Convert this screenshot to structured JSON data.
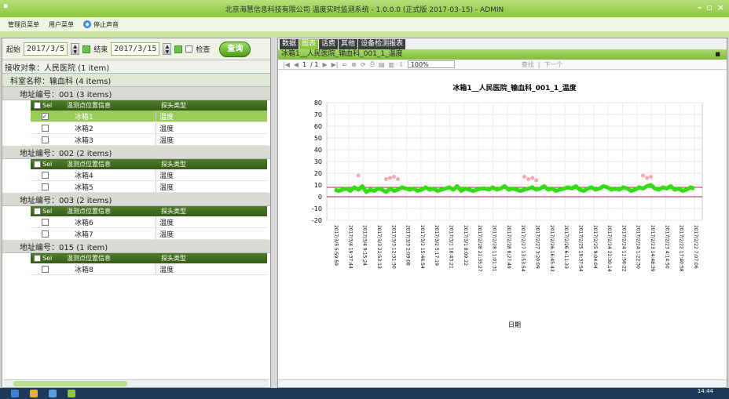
{
  "window": {
    "title": "北京海慧信息科技有限公司 温度实时监测系统 - 1.0.0.0 (正式版 2017-03-15) - ADMIN",
    "icon": "app-icon"
  },
  "menu": {
    "admin": "管理员菜单",
    "user": "用户菜单",
    "stop_sound": "停止声音"
  },
  "filter": {
    "start_label": "起始",
    "start_value": "2017/3/5",
    "end_label": "结束",
    "end_value": "2017/3/15",
    "check_label": "检查",
    "query_label": "查询"
  },
  "tree": {
    "recipient": "接收对象：人民医院 (1 item)",
    "dept": "科室名称：输血科 (4 items)",
    "col_sel": "Sel",
    "col_loc": "温测点位置信息",
    "col_type": "探头类型",
    "groups": [
      {
        "label": "地址编号：001 (3 items)",
        "rows": [
          {
            "name": "冰箱1",
            "type": "温度",
            "selected": true
          },
          {
            "name": "冰箱2",
            "type": "温度",
            "selected": false
          },
          {
            "name": "冰箱3",
            "type": "温度",
            "selected": false
          }
        ]
      },
      {
        "label": "地址编号：002 (2 items)",
        "rows": [
          {
            "name": "冰箱4",
            "type": "温度",
            "selected": false
          },
          {
            "name": "冰箱5",
            "type": "温度",
            "selected": false
          }
        ]
      },
      {
        "label": "地址编号：003 (2 items)",
        "rows": [
          {
            "name": "冰箱6",
            "type": "温度",
            "selected": false
          },
          {
            "name": "冰箱7",
            "type": "温度",
            "selected": false
          }
        ]
      },
      {
        "label": "地址编号：015 (1 item)",
        "rows": [
          {
            "name": "冰箱8",
            "type": "温度",
            "selected": false
          }
        ]
      }
    ]
  },
  "tabs": [
    {
      "label": "数据",
      "active": false
    },
    {
      "label": "图表",
      "active": true
    },
    {
      "label": "话费",
      "active": false
    },
    {
      "label": "其他",
      "active": false
    },
    {
      "label": "设备检测报表",
      "active": false
    }
  ],
  "report": {
    "title": "冰箱1__人民医院_输血科_001_1_温度",
    "page": "1",
    "page_total": "/ 1",
    "zoom": "100%",
    "find": "查找",
    "next": "下一个"
  },
  "chart_data": {
    "type": "line",
    "title": "冰箱1__人民医院_输血科_001_1_温度",
    "xlabel": "日期",
    "ylabel": "",
    "ylim": [
      -20,
      80
    ],
    "yticks": [
      80,
      70,
      60,
      50,
      40,
      30,
      20,
      10,
      0,
      -10,
      -20
    ],
    "upper_limit": 8,
    "lower_limit": 0,
    "x": [
      "2017/3/5 5:59:59",
      "2017/3/4 19:37:44",
      "2017/3/4 9:15:24",
      "2017/3/3 22:53:13",
      "2017/3/3 12:31:30",
      "2017/3/3 2:09:08",
      "2017/3/2 15:46:54",
      "2017/3/2 5:17:19",
      "2017/3/1 18:43:21",
      "2017/3/1 8:09:22",
      "2017/2/28 21:35:27",
      "2017/2/28 11:01:31",
      "2017/2/28 0:27:49",
      "2017/2/27 13:53:54",
      "2017/2/27 3:20:09",
      "2017/2/26 16:45:43",
      "2017/2/26 6:11:33",
      "2017/2/25 19:37:54",
      "2017/2/25 9:04:04",
      "2017/2/24 22:30:14",
      "2017/2/24 11:56:22",
      "2017/2/24 1:22:30",
      "2017/2/23 14:48:39",
      "2017/2/23 4:14:50",
      "2017/2/22 17:40:58",
      "2017/2/22 7:07:06"
    ],
    "series": [
      {
        "color": "#33dd11",
        "values": [
          6,
          5,
          6,
          7,
          5,
          8,
          6,
          9,
          4,
          6,
          5,
          7,
          6,
          4,
          7,
          5,
          6,
          8,
          7,
          6,
          7,
          5,
          6,
          8,
          6,
          7,
          5,
          6,
          7,
          8,
          6,
          9,
          5,
          7,
          6,
          5,
          6,
          7,
          7,
          6,
          8,
          6,
          7,
          9,
          6,
          7,
          6,
          5,
          6,
          7,
          8,
          6,
          7,
          9,
          6,
          7,
          5,
          6,
          7,
          8,
          7,
          9,
          6,
          5,
          7,
          8,
          6,
          7,
          9,
          8,
          6,
          7,
          6,
          8,
          7,
          5,
          6,
          8,
          7,
          9,
          10,
          7,
          6,
          8,
          7,
          9,
          6,
          7,
          5,
          6,
          8,
          7
        ]
      },
      {
        "color": "#f4a6b4",
        "values": [
          null,
          null,
          null,
          null,
          null,
          null,
          18,
          null,
          null,
          null,
          null,
          null,
          null,
          15,
          16,
          17,
          15,
          null,
          null,
          null,
          null,
          null,
          null,
          null,
          null,
          null,
          null,
          null,
          null,
          null,
          null,
          null,
          null,
          null,
          null,
          null,
          null,
          null,
          null,
          null,
          null,
          null,
          null,
          null,
          null,
          null,
          null,
          null,
          17,
          15,
          16,
          14,
          null,
          null,
          null,
          null,
          null,
          null,
          null,
          null,
          null,
          null,
          null,
          null,
          null,
          null,
          null,
          null,
          null,
          null,
          null,
          null,
          null,
          null,
          null,
          null,
          null,
          null,
          18,
          16,
          17,
          null,
          null,
          null,
          null,
          null,
          null,
          null,
          null,
          null,
          null,
          null
        ]
      }
    ]
  },
  "taskbar": {
    "time": "14:44"
  }
}
